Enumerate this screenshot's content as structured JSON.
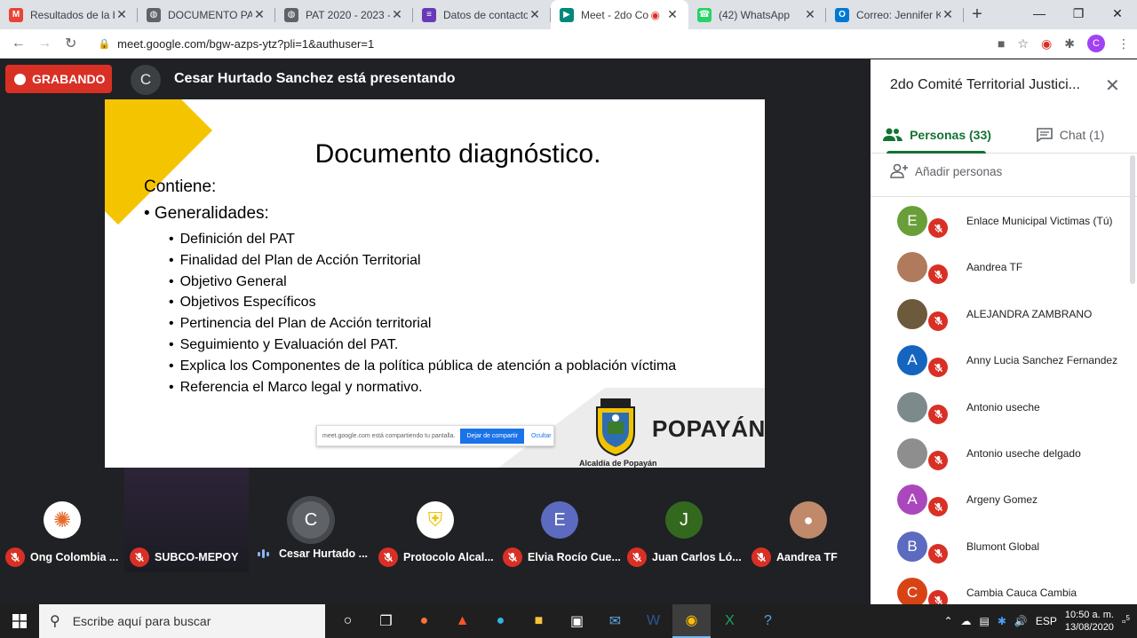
{
  "browser": {
    "tabs": [
      {
        "title": "Resultados de la b",
        "icon": "gmail-icon",
        "color": "#ea4335",
        "glyph": "M",
        "active": false
      },
      {
        "title": "DOCUMENTO PAT",
        "icon": "globe-icon",
        "color": "#5f6368",
        "glyph": "◍",
        "active": false
      },
      {
        "title": "PAT 2020 - 2023 -",
        "icon": "globe-icon",
        "color": "#5f6368",
        "glyph": "◍",
        "active": false
      },
      {
        "title": "Datos de contacto",
        "icon": "forms-icon",
        "color": "#673ab7",
        "glyph": "≡",
        "active": false
      },
      {
        "title": "Meet - 2do Co",
        "icon": "meet-icon",
        "color": "#00897b",
        "glyph": "▶",
        "active": true
      },
      {
        "title": "(42) WhatsApp",
        "icon": "whatsapp-icon",
        "color": "#25d366",
        "glyph": "☎",
        "active": false
      },
      {
        "title": "Correo: Jennifer Ka",
        "icon": "outlook-icon",
        "color": "#0078d4",
        "glyph": "O",
        "active": false
      }
    ],
    "url": "meet.google.com/bgw-azps-ytz?pli=1&authuser=1",
    "profile_initial": "C"
  },
  "meet": {
    "recording_label": "GRABANDO",
    "presenter_initial": "C",
    "presenter_text": "Cesar Hurtado Sanchez está presentando",
    "slide": {
      "title": "Documento diagnóstico.",
      "contiene": "Contiene:",
      "section": "• Generalidades:",
      "bullets": [
        "Definición  del PAT",
        "Finalidad del Plan de Acción Territorial",
        "Objetivo General",
        "Objetivos Específicos",
        "Pertinencia del Plan de Acción territorial",
        "Seguimiento y Evaluación del PAT.",
        "Explica los Componentes de la política pública de atención a población víctima",
        "Referencia el Marco legal y normativo."
      ],
      "share_notice": "meet.google.com está compartiendo tu pantalla.",
      "stop_sharing": "Dejar de compartir",
      "hide": "Ocultar",
      "logo_text": "POPAYÁN",
      "alcaldia": "Alcaldía de Popayán"
    },
    "participants_strip": [
      {
        "name": "Ong Colombia ...",
        "avatar": "photo",
        "initial": "",
        "color": "#ffffff",
        "muted": true
      },
      {
        "name": "SUBCO-MEPOY",
        "avatar": "video",
        "initial": "",
        "color": "#2b2433",
        "muted": true
      },
      {
        "name": "Cesar Hurtado ...",
        "avatar": "initial",
        "initial": "C",
        "color": "#5f6368",
        "muted": false
      },
      {
        "name": "Protocolo Alcal...",
        "avatar": "crest",
        "initial": "",
        "color": "#ffffff",
        "muted": true
      },
      {
        "name": "Elvia Rocío Cue...",
        "avatar": "initial",
        "initial": "E",
        "color": "#5c6bc0",
        "muted": true
      },
      {
        "name": "Juan Carlos Ló...",
        "avatar": "initial",
        "initial": "J",
        "color": "#33691e",
        "muted": true
      },
      {
        "name": "Aandrea TF",
        "avatar": "photo",
        "initial": "",
        "color": "#c08a6a",
        "muted": true
      }
    ]
  },
  "panel": {
    "title": "2do Comité Territorial Justici...",
    "tab_people": "Personas (33)",
    "tab_chat": "Chat (1)",
    "add_people": "Añadir personas",
    "people": [
      {
        "name": "Enlace Municipal Victimas (Tú)",
        "initial": "E",
        "color": "#689f38"
      },
      {
        "name": "Aandrea TF",
        "initial": "",
        "color": "#b07a5c"
      },
      {
        "name": "ALEJANDRA ZAMBRANO",
        "initial": "",
        "color": "#6d5a3c"
      },
      {
        "name": "Anny Lucia Sanchez Fernandez",
        "initial": "A",
        "color": "#1565c0"
      },
      {
        "name": "Antonio useche",
        "initial": "",
        "color": "#7d8a8c"
      },
      {
        "name": "Antonio useche delgado",
        "initial": "",
        "color": "#8e8e8e"
      },
      {
        "name": "Argeny Gomez",
        "initial": "A",
        "color": "#ab47bc"
      },
      {
        "name": "Blumont Global",
        "initial": "B",
        "color": "#5c6bc0"
      },
      {
        "name": "Cambia Cauca Cambia",
        "initial": "C",
        "color": "#d84315"
      }
    ]
  },
  "taskbar": {
    "search_placeholder": "Escribe aquí para buscar",
    "language": "ESP",
    "time": "10:50 a. m.",
    "date": "13/08/2020",
    "notifications": "5"
  }
}
